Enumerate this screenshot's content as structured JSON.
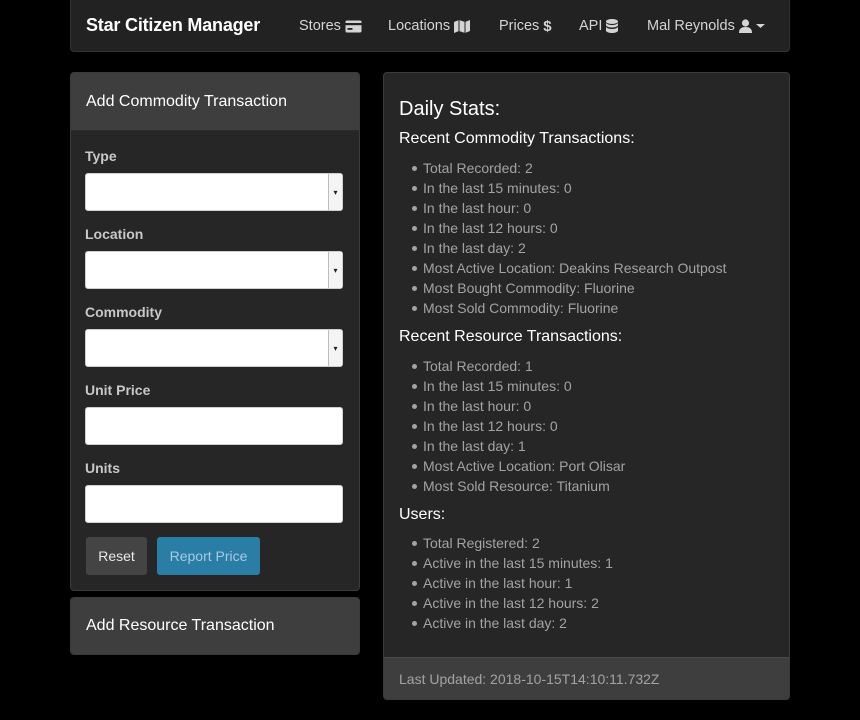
{
  "nav": {
    "brand": "Star Citizen Manager",
    "items": [
      {
        "label": "Stores",
        "icon": "credit-card-icon"
      },
      {
        "label": "Locations",
        "icon": "map-icon"
      },
      {
        "label": "Prices",
        "icon": "dollar-icon"
      },
      {
        "label": "API",
        "icon": "database-icon"
      }
    ],
    "user": {
      "label": "Mal Reynolds",
      "icon": "user-icon"
    }
  },
  "commodity_form": {
    "title": "Add Commodity Transaction",
    "fields": [
      {
        "label": "Type",
        "value": ""
      },
      {
        "label": "Location",
        "value": ""
      },
      {
        "label": "Commodity",
        "value": ""
      },
      {
        "label": "Unit Price",
        "value": ""
      },
      {
        "label": "Units",
        "value": ""
      }
    ],
    "reset_label": "Reset",
    "submit_label": "Report Price"
  },
  "resource_form": {
    "title": "Add Resource Transaction"
  },
  "stats": {
    "title": "Daily Stats:",
    "commodity": {
      "title": "Recent Commodity Transactions:",
      "items": [
        "Total Recorded: 2",
        "In the last 15 minutes: 0",
        "In the last hour: 0",
        "In the last 12 hours: 0",
        "In the last day: 2",
        "Most Active Location: Deakins Research Outpost",
        "Most Bought Commodity: Fluorine",
        "Most Sold Commodity: Fluorine"
      ]
    },
    "resource": {
      "title": "Recent Resource Transactions:",
      "items": [
        "Total Recorded: 1",
        "In the last 15 minutes: 0",
        "In the last hour: 0",
        "In the last 12 hours: 0",
        "In the last day: 1",
        "Most Active Location: Port Olisar",
        "Most Sold Resource: Titanium"
      ]
    },
    "users": {
      "title": "Users:",
      "items": [
        "Total Registered: 2",
        "Active in the last 15 minutes: 1",
        "Active in the last hour: 1",
        "Active in the last 12 hours: 2",
        "Active in the last day: 2"
      ]
    },
    "footer": "Last Updated: 2018-10-15T14:10:11.732Z"
  }
}
